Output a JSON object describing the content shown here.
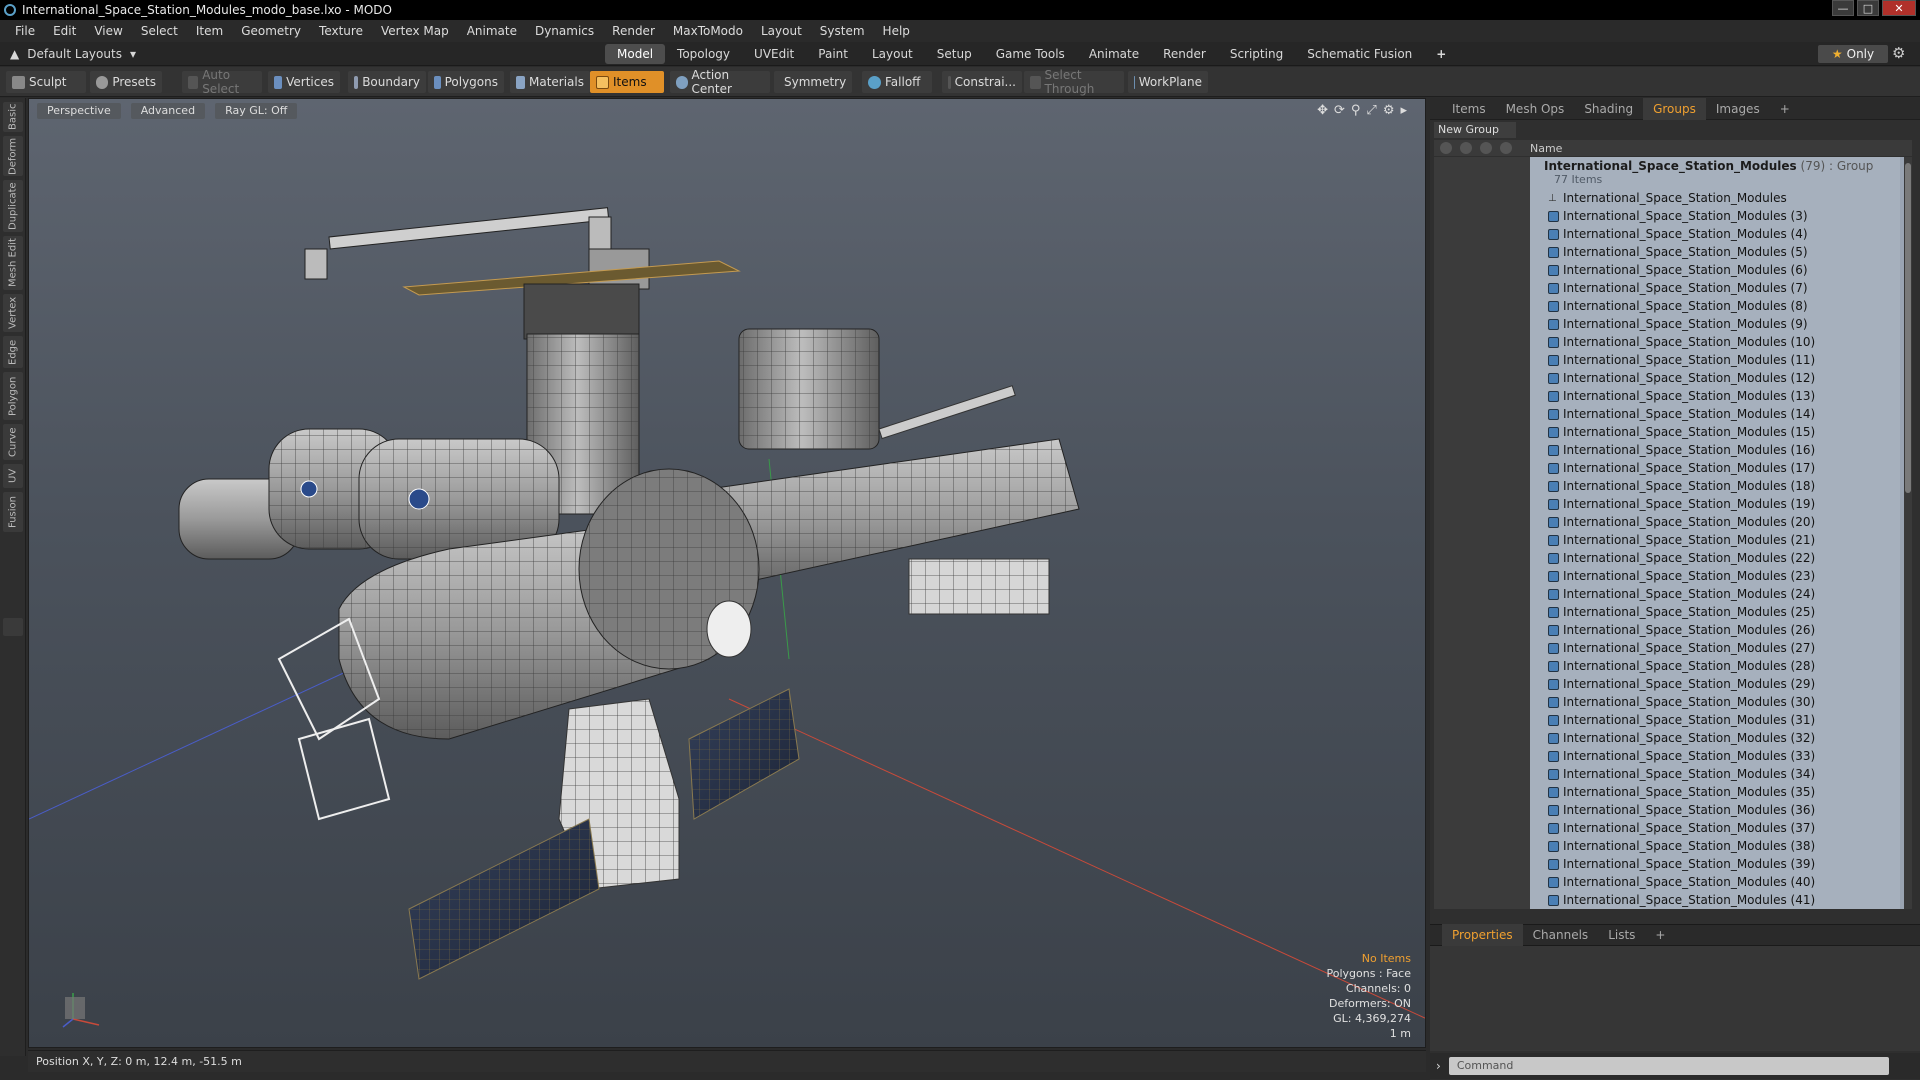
{
  "window": {
    "title": "International_Space_Station_Modules_modo_base.lxo - MODO"
  },
  "menu": [
    "File",
    "Edit",
    "View",
    "Select",
    "Item",
    "Geometry",
    "Texture",
    "Vertex Map",
    "Animate",
    "Dynamics",
    "Render",
    "MaxToModo",
    "Layout",
    "System",
    "Help"
  ],
  "layoutbar": {
    "default_layouts": "Default Layouts",
    "tabs": [
      "Model",
      "Topology",
      "UVEdit",
      "Paint",
      "Layout",
      "Setup",
      "Game Tools",
      "Animate",
      "Render",
      "Scripting",
      "Schematic Fusion"
    ],
    "active_tab": "Model",
    "only_label": "Only"
  },
  "toolbar": {
    "sculpt": "Sculpt",
    "presets": "Presets",
    "auto_select": "Auto Select",
    "vertices": "Vertices",
    "boundary": "Boundary",
    "polygons": "Polygons",
    "materials": "Materials",
    "items": "Items",
    "action_center": "Action Center",
    "symmetry": "Symmetry",
    "falloff": "Falloff",
    "constraints": "Constrai...",
    "select_through": "Select Through",
    "workplane": "WorkPlane"
  },
  "left_tabs": [
    "Basic",
    "Deform",
    "Duplicate",
    "Mesh Edit",
    "Vertex",
    "Edge",
    "Polygon",
    "Curve",
    "UV",
    "Fusion"
  ],
  "viewport": {
    "perspective": "Perspective",
    "advanced": "Advanced",
    "raygl": "Ray GL: Off",
    "info": {
      "no_items": "No Items",
      "polygons": "Polygons : Face",
      "channels": "Channels: 0",
      "deformers": "Deformers: ON",
      "gl": "GL: 4,369,274",
      "scale": "1 m"
    }
  },
  "status": {
    "position": "Position X, Y, Z:  0 m, 12.4 m, -51.5 m"
  },
  "right_panel": {
    "tabs": [
      "Items",
      "Mesh Ops",
      "Shading",
      "Groups",
      "Images"
    ],
    "active_tab": "Groups",
    "new_group": "New Group",
    "column_name": "Name",
    "group": {
      "name": "International_Space_Station_Modules",
      "count": "(79)",
      "type": ": Group",
      "items": "77 Items"
    },
    "rows": [
      "International_Space_Station_Modules",
      "International_Space_Station_Modules (3)",
      "International_Space_Station_Modules (4)",
      "International_Space_Station_Modules (5)",
      "International_Space_Station_Modules (6)",
      "International_Space_Station_Modules (7)",
      "International_Space_Station_Modules (8)",
      "International_Space_Station_Modules (9)",
      "International_Space_Station_Modules (10)",
      "International_Space_Station_Modules (11)",
      "International_Space_Station_Modules (12)",
      "International_Space_Station_Modules (13)",
      "International_Space_Station_Modules (14)",
      "International_Space_Station_Modules (15)",
      "International_Space_Station_Modules (16)",
      "International_Space_Station_Modules (17)",
      "International_Space_Station_Modules (18)",
      "International_Space_Station_Modules (19)",
      "International_Space_Station_Modules (20)",
      "International_Space_Station_Modules (21)",
      "International_Space_Station_Modules (22)",
      "International_Space_Station_Modules (23)",
      "International_Space_Station_Modules (24)",
      "International_Space_Station_Modules (25)",
      "International_Space_Station_Modules (26)",
      "International_Space_Station_Modules (27)",
      "International_Space_Station_Modules (28)",
      "International_Space_Station_Modules (29)",
      "International_Space_Station_Modules (30)",
      "International_Space_Station_Modules (31)",
      "International_Space_Station_Modules (32)",
      "International_Space_Station_Modules (33)",
      "International_Space_Station_Modules (34)",
      "International_Space_Station_Modules (35)",
      "International_Space_Station_Modules (36)",
      "International_Space_Station_Modules (37)",
      "International_Space_Station_Modules (38)",
      "International_Space_Station_Modules (39)",
      "International_Space_Station_Modules (40)",
      "International_Space_Station_Modules (41)"
    ],
    "prop_tabs": [
      "Properties",
      "Channels",
      "Lists"
    ],
    "prop_active": "Properties",
    "command_placeholder": "Command"
  },
  "colors": {
    "accent": "#e09028",
    "active_tab_text": "#f0a030",
    "list_bg": "#a6b0bd"
  }
}
